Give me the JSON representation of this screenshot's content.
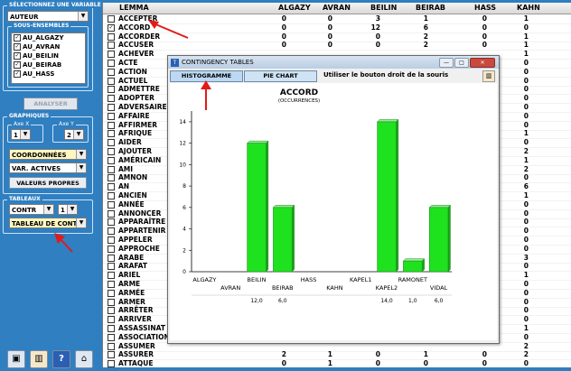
{
  "left_panel": {
    "select_var_title": "SÉLECTIONNEZ UNE VARIABLE",
    "var_value": "AUTEUR",
    "subsets_title": "SOUS-ENSEMBLES",
    "subsets": [
      "AU_ALGAZY",
      "AU_AVRAN",
      "AU_BEILIN",
      "AU_BEIRAB",
      "AU_HASS"
    ],
    "analyze_label": "ANALYSER",
    "graphs_title": "GRAPHIQUES",
    "axe_x_label": "Axe X",
    "axe_y_label": "Axe Y",
    "axe_x_value": "1",
    "axe_y_value": "2",
    "coords_value": "COORDONNÉES",
    "vars_value": "VAR. ACTIVES",
    "valeurs_label": "VALEURS PROPRES",
    "tables_title": "TABLEAUX",
    "contr_value": "CONTR",
    "contr_num": "1",
    "table_type_value": "TABLEAU DE CONT"
  },
  "table": {
    "headers": [
      "LEMMA",
      "ALGAZY",
      "AVRAN",
      "BEILIN",
      "BEIRAB",
      "HASS",
      "KAHN"
    ],
    "rows": [
      {
        "lemma": "ACCEPTER",
        "checked": false,
        "vals": [
          "0",
          "0",
          "3",
          "1",
          "0",
          "1"
        ]
      },
      {
        "lemma": "ACCORD",
        "checked": true,
        "vals": [
          "0",
          "0",
          "12",
          "6",
          "0",
          "0"
        ]
      },
      {
        "lemma": "ACCORDER",
        "checked": false,
        "vals": [
          "0",
          "0",
          "0",
          "2",
          "0",
          "1"
        ]
      },
      {
        "lemma": "ACCUSER",
        "checked": false,
        "vals": [
          "0",
          "0",
          "0",
          "2",
          "0",
          "1"
        ]
      },
      {
        "lemma": "ACHEVER",
        "checked": false,
        "vals": [
          "",
          "",
          "",
          "",
          "",
          "1"
        ]
      },
      {
        "lemma": "ACTE",
        "checked": false,
        "vals": [
          "",
          "",
          "",
          "",
          "",
          "0"
        ]
      },
      {
        "lemma": "ACTION",
        "checked": false,
        "vals": [
          "",
          "",
          "",
          "",
          "",
          "0"
        ]
      },
      {
        "lemma": "ACTUEL",
        "checked": false,
        "vals": [
          "",
          "",
          "",
          "",
          "",
          "0"
        ]
      },
      {
        "lemma": "ADMETTRE",
        "checked": false,
        "vals": [
          "",
          "",
          "",
          "",
          "",
          "0"
        ]
      },
      {
        "lemma": "ADOPTER",
        "checked": false,
        "vals": [
          "",
          "",
          "",
          "",
          "",
          "0"
        ]
      },
      {
        "lemma": "ADVERSAIRE",
        "checked": false,
        "vals": [
          "",
          "",
          "",
          "",
          "",
          "0"
        ]
      },
      {
        "lemma": "AFFAIRE",
        "checked": false,
        "vals": [
          "",
          "",
          "",
          "",
          "",
          "0"
        ]
      },
      {
        "lemma": "AFFIRMER",
        "checked": false,
        "vals": [
          "",
          "",
          "",
          "",
          "",
          "0"
        ]
      },
      {
        "lemma": "AFRIQUE",
        "checked": false,
        "vals": [
          "",
          "",
          "",
          "",
          "",
          "1"
        ]
      },
      {
        "lemma": "AIDER",
        "checked": false,
        "vals": [
          "",
          "",
          "",
          "",
          "",
          "0"
        ]
      },
      {
        "lemma": "AJOUTER",
        "checked": false,
        "vals": [
          "",
          "",
          "",
          "",
          "",
          "2"
        ]
      },
      {
        "lemma": "AMÉRICAIN",
        "checked": false,
        "vals": [
          "",
          "",
          "",
          "",
          "",
          "1"
        ]
      },
      {
        "lemma": "AMI",
        "checked": false,
        "vals": [
          "",
          "",
          "",
          "",
          "",
          "2"
        ]
      },
      {
        "lemma": "AMNON",
        "checked": false,
        "vals": [
          "",
          "",
          "",
          "",
          "",
          "0"
        ]
      },
      {
        "lemma": "AN",
        "checked": false,
        "vals": [
          "",
          "",
          "",
          "",
          "",
          "6"
        ]
      },
      {
        "lemma": "ANCIEN",
        "checked": false,
        "vals": [
          "",
          "",
          "",
          "",
          "",
          "1"
        ]
      },
      {
        "lemma": "ANNÉE",
        "checked": false,
        "vals": [
          "",
          "",
          "",
          "",
          "",
          "0"
        ]
      },
      {
        "lemma": "ANNONCER",
        "checked": false,
        "vals": [
          "",
          "",
          "",
          "",
          "",
          "0"
        ]
      },
      {
        "lemma": "APPARAÎTRE",
        "checked": false,
        "vals": [
          "",
          "",
          "",
          "",
          "",
          "0"
        ]
      },
      {
        "lemma": "APPARTENIR",
        "checked": false,
        "vals": [
          "",
          "",
          "",
          "",
          "",
          "0"
        ]
      },
      {
        "lemma": "APPELER",
        "checked": false,
        "vals": [
          "",
          "",
          "",
          "",
          "",
          "0"
        ]
      },
      {
        "lemma": "APPROCHE",
        "checked": false,
        "vals": [
          "",
          "",
          "",
          "",
          "",
          "0"
        ]
      },
      {
        "lemma": "ARABE",
        "checked": false,
        "vals": [
          "",
          "",
          "",
          "",
          "",
          "3"
        ]
      },
      {
        "lemma": "ARAFAT",
        "checked": false,
        "vals": [
          "",
          "",
          "",
          "",
          "",
          "0"
        ]
      },
      {
        "lemma": "ARIEL",
        "checked": false,
        "vals": [
          "",
          "",
          "",
          "",
          "",
          "1"
        ]
      },
      {
        "lemma": "ARME",
        "checked": false,
        "vals": [
          "",
          "",
          "",
          "",
          "",
          "0"
        ]
      },
      {
        "lemma": "ARMÉE",
        "checked": false,
        "vals": [
          "",
          "",
          "",
          "",
          "",
          "0"
        ]
      },
      {
        "lemma": "ARMER",
        "checked": false,
        "vals": [
          "",
          "",
          "",
          "",
          "",
          "0"
        ]
      },
      {
        "lemma": "ARRÊTER",
        "checked": false,
        "vals": [
          "",
          "",
          "",
          "",
          "",
          "0"
        ]
      },
      {
        "lemma": "ARRIVER",
        "checked": false,
        "vals": [
          "",
          "",
          "",
          "",
          "",
          "0"
        ]
      },
      {
        "lemma": "ASSASSINAT",
        "checked": false,
        "vals": [
          "",
          "",
          "",
          "",
          "",
          "1"
        ]
      },
      {
        "lemma": "ASSOCIATION",
        "checked": false,
        "vals": [
          "",
          "",
          "",
          "",
          "",
          "0"
        ]
      },
      {
        "lemma": "ASSUMER",
        "checked": false,
        "vals": [
          "",
          "",
          "",
          "",
          "",
          "2"
        ]
      },
      {
        "lemma": "ASSURER",
        "checked": false,
        "vals": [
          "2",
          "1",
          "0",
          "1",
          "0",
          "2"
        ]
      },
      {
        "lemma": "ATTAQUE",
        "checked": false,
        "vals": [
          "0",
          "1",
          "0",
          "0",
          "0",
          "0"
        ]
      }
    ]
  },
  "dialog": {
    "title": "CONTINGENCY TABLES",
    "tab_hist": "HISTOGRAMME",
    "tab_pie": "PIE CHART",
    "hint": "Utiliser le bouton droit de la souris",
    "bar_color": "#1ee21e",
    "accent_color": "#1a0fc2"
  },
  "chart_data": {
    "type": "bar",
    "title": "ACCORD",
    "subtitle": "(OCCURRENCES)",
    "categories": [
      "ALGAZY",
      "AVRAN",
      "BEILIN",
      "BEIRAB",
      "HASS",
      "KAHN",
      "KAPEL1",
      "KAPEL2",
      "RAMONET",
      "VIDAL"
    ],
    "values": [
      0,
      0,
      12,
      6,
      0,
      0,
      0,
      14,
      1,
      6
    ],
    "value_labels": [
      "",
      "",
      "12,0",
      "6,0",
      "",
      "",
      "",
      "14,0",
      "1,0",
      "6,0"
    ],
    "yticks": [
      "0",
      "2",
      "4",
      "6",
      "8",
      "10",
      "12",
      "14"
    ],
    "ylim": [
      0,
      14.5
    ]
  }
}
